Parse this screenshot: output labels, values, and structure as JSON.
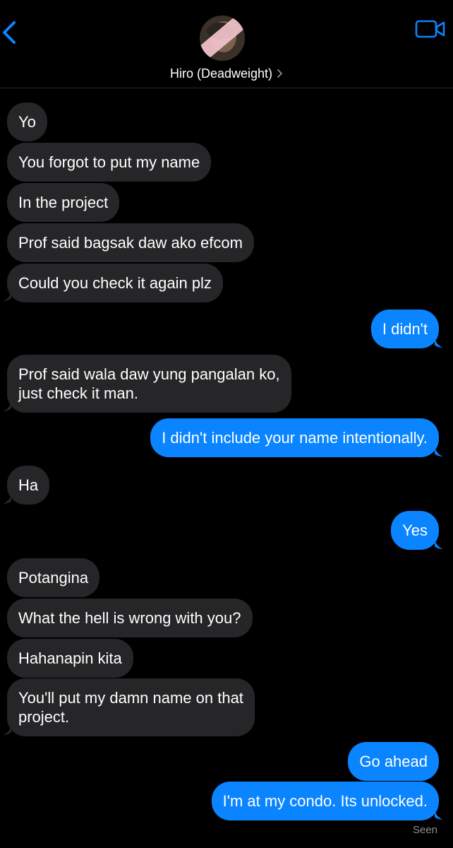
{
  "header": {
    "contact_name": "Hiro (Deadweight)",
    "back_icon": "chevron-left-icon",
    "video_icon": "video-camera-icon",
    "accent_color": "#0a84ff"
  },
  "messages": [
    {
      "from": "them",
      "text": "Yo"
    },
    {
      "from": "them",
      "text": "You forgot to put my name"
    },
    {
      "from": "them",
      "text": "In the project"
    },
    {
      "from": "them",
      "text": "Prof said bagsak daw ako efcom"
    },
    {
      "from": "them",
      "text": "Could you check it again plz"
    },
    {
      "from": "me",
      "text": "I didn't"
    },
    {
      "from": "them",
      "text": "Prof said wala daw yung pangalan ko,\njust check it man."
    },
    {
      "from": "me",
      "text": "I didn't include your name intentionally."
    },
    {
      "from": "them",
      "text": "Ha"
    },
    {
      "from": "me",
      "text": "Yes"
    },
    {
      "from": "them",
      "text": "Potangina"
    },
    {
      "from": "them",
      "text": "What the hell is wrong with you?"
    },
    {
      "from": "them",
      "text": "Hahanapin kita"
    },
    {
      "from": "them",
      "text": "You'll put my damn name on that\nproject."
    },
    {
      "from": "me",
      "text": "Go ahead"
    },
    {
      "from": "me",
      "text": "I'm at my condo. Its unlocked."
    }
  ],
  "status": {
    "seen_label": "Seen"
  },
  "colors": {
    "incoming_bubble": "#262628",
    "outgoing_bubble": "#0a84ff",
    "background": "#000000"
  }
}
